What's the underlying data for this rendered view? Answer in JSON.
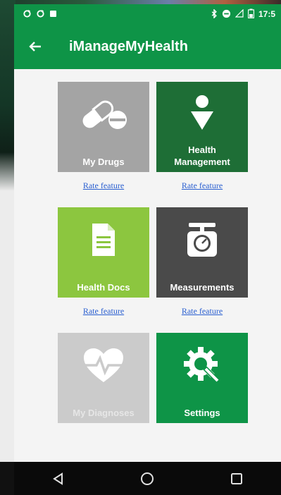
{
  "status_bar": {
    "time": "17:5",
    "left_icons": [
      "sync-icon",
      "sync-icon",
      "notification-icon"
    ],
    "right_icons": [
      "bluetooth-icon",
      "do-not-disturb-icon",
      "wifi-icon",
      "battery-icon"
    ]
  },
  "app_bar": {
    "title": "iManageMyHealth",
    "back_icon": "arrow-back-icon"
  },
  "tiles": [
    {
      "label": "My Drugs",
      "icon": "pill-icon",
      "color": "#a4a4a4",
      "rate_label": "Rate feature"
    },
    {
      "label_line1": "Health",
      "label_line2": "Management",
      "icon": "person-icon",
      "color": "#1e6e36",
      "rate_label": "Rate feature"
    },
    {
      "label": "Health Docs",
      "icon": "document-icon",
      "color": "#8cc63f",
      "rate_label": "Rate feature"
    },
    {
      "label": "Measurements",
      "icon": "scale-icon",
      "color": "#4a4a4a",
      "rate_label": "Rate feature"
    },
    {
      "label": "My Diagnoses",
      "icon": "heart-pulse-icon",
      "color": "#cbcbcb"
    },
    {
      "label": "Settings",
      "icon": "gear-icon",
      "color": "#0e9447"
    }
  ],
  "nav_bar": {
    "back": "nav-back-icon",
    "home": "nav-home-icon",
    "recents": "nav-recents-icon"
  }
}
